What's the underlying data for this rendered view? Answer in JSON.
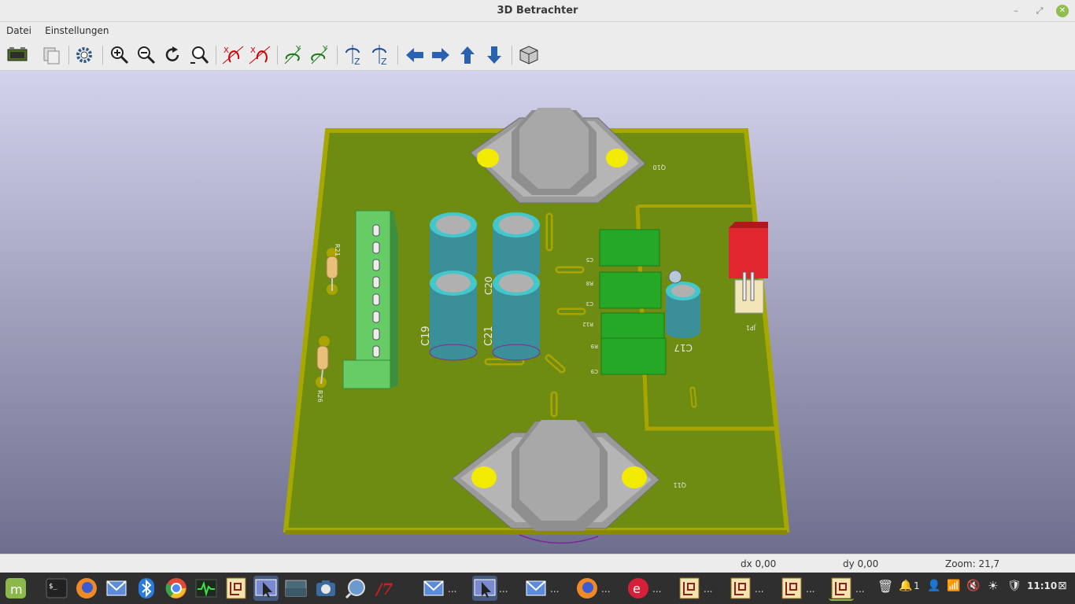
{
  "window": {
    "title": "3D Betrachter",
    "minimize_glyph": "–",
    "restore_glyph": "⤢",
    "close_glyph": "✕"
  },
  "menu": {
    "items": [
      "Datei",
      "Einstellungen"
    ]
  },
  "toolbar": {
    "buttons": [
      "reload-board-icon",
      "copy-image-icon",
      "settings-gear-icon",
      "zoom-in-icon",
      "zoom-out-icon",
      "redraw-icon",
      "zoom-fit-icon",
      "rotate-x-cw-icon",
      "rotate-x-ccw-icon",
      "rotate-y-cw-icon",
      "rotate-y-ccw-icon",
      "rotate-z-cw-icon",
      "rotate-z-ccw-icon",
      "move-left-icon",
      "move-right-icon",
      "move-up-icon",
      "move-down-icon",
      "orthographic-icon"
    ]
  },
  "board": {
    "colors": {
      "pcb": "#6f8c12",
      "edge": "#a6a800",
      "copper": "#a9a400",
      "pad": "#f2ea00",
      "metal": "#a6a6a6",
      "cap_body": "#3a8f98",
      "cap_top": "#44c7cc",
      "resistor_green": "#25a825",
      "connector": "#66cc66",
      "led_red": "#e0262f"
    },
    "silkscreen": [
      "C19",
      "C21",
      "C17",
      "C20",
      "R21",
      "R26",
      "Q10",
      "Q11",
      "JP1",
      "C5",
      "R8",
      "C3",
      "R12",
      "R9",
      "C9"
    ]
  },
  "status": {
    "dx": "dx 0,00",
    "dy": "dy 0,00",
    "zoom": "Zoom: 21,7"
  },
  "taskbar": {
    "apps": [
      {
        "name": "mint-menu-icon",
        "dots": ""
      },
      {
        "name": "terminal-icon",
        "dots": ""
      },
      {
        "name": "firefox-icon",
        "dots": ""
      },
      {
        "name": "mail-icon",
        "dots": ""
      },
      {
        "name": "bluetooth-icon",
        "dots": ""
      },
      {
        "name": "chromium-icon",
        "dots": ""
      },
      {
        "name": "system-monitor-icon",
        "dots": ""
      },
      {
        "name": "kicad-schematic-icon",
        "dots": ""
      },
      {
        "name": "screenshot-tool-icon",
        "dots": ""
      },
      {
        "name": "desktop-icon",
        "dots": ""
      },
      {
        "name": "camera-icon",
        "dots": ""
      },
      {
        "name": "magnifier-icon",
        "dots": ""
      },
      {
        "name": "kicad-logo-icon",
        "dots": ""
      },
      {
        "name": "mail-window-icon",
        "dots": "..."
      },
      {
        "name": "screenshot-window-icon",
        "dots": "..."
      },
      {
        "name": "mail-window-2-icon",
        "dots": "..."
      },
      {
        "name": "firefox-window-icon",
        "dots": "..."
      },
      {
        "name": "editor-window-icon",
        "dots": "..."
      },
      {
        "name": "kicad-window-1-icon",
        "dots": "..."
      },
      {
        "name": "kicad-window-2-icon",
        "dots": "..."
      },
      {
        "name": "kicad-window-3-icon",
        "dots": "..."
      },
      {
        "name": "kicad-window-4-icon",
        "dots": "..."
      }
    ],
    "tray": {
      "notifications": "1",
      "clock": "11:10"
    }
  }
}
